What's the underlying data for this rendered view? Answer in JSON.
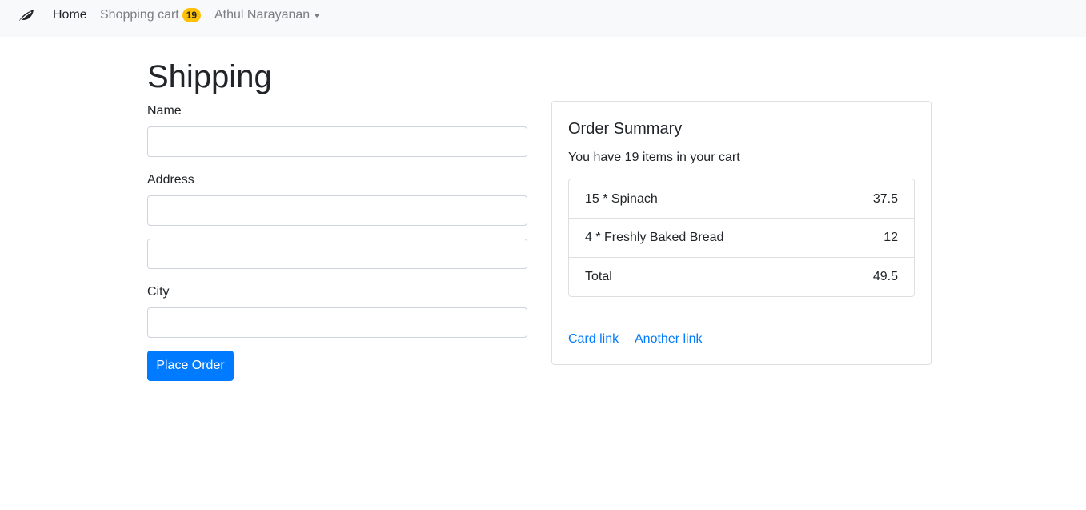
{
  "navbar": {
    "brand_icon": "leaf-icon",
    "home_label": "Home",
    "cart_label": "Shopping cart",
    "cart_count": "19",
    "user_label": "Athul Narayanan",
    "badge_color": "#ffc107"
  },
  "form": {
    "title": "Shipping",
    "name_label": "Name",
    "name_value": "",
    "address_label": "Address",
    "address_line1_value": "",
    "address_line2_value": "",
    "city_label": "City",
    "city_value": "",
    "submit_label": "Place Order",
    "accent_color": "#007bff"
  },
  "summary": {
    "title": "Order Summary",
    "subtitle": "You have 19 items in your cart",
    "items": [
      {
        "name": "15 * Spinach",
        "price": "37.5"
      },
      {
        "name": "4 * Freshly Baked Bread",
        "price": "12"
      }
    ],
    "total_label": "Total",
    "total_value": "49.5",
    "link1": "Card link",
    "link2": "Another link"
  }
}
